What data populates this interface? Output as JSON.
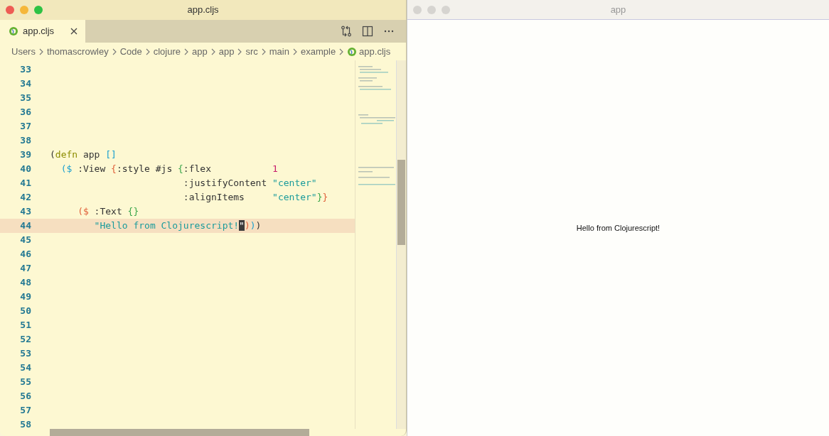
{
  "editor_window": {
    "title": "app.cljs",
    "tabs": [
      {
        "label": "app.cljs",
        "selected": true
      }
    ],
    "breadcrumbs": [
      "Users",
      "thomascrowley",
      "Code",
      "clojure",
      "app",
      "app",
      "src",
      "main",
      "example",
      "app.cljs"
    ],
    "code_lines": [
      {
        "number": "33",
        "highlighted": false
      },
      {
        "number": "34",
        "highlighted": false
      },
      {
        "number": "35",
        "highlighted": false
      },
      {
        "number": "36",
        "highlighted": false
      },
      {
        "number": "37",
        "highlighted": false
      },
      {
        "number": "38",
        "highlighted": false
      },
      {
        "number": "39",
        "highlighted": false,
        "tokens": [
          {
            "kind": "bracket1",
            "text": "("
          },
          {
            "kind": "keyword",
            "text": "defn"
          },
          {
            "kind": "plain",
            "text": " app "
          },
          {
            "kind": "bracket2",
            "text": "[]"
          }
        ]
      },
      {
        "number": "40",
        "highlighted": false,
        "tokens": [
          {
            "kind": "bracket2",
            "text": "  ($"
          },
          {
            "kind": "plain",
            "text": " :View "
          },
          {
            "kind": "bracket3",
            "text": "{"
          },
          {
            "kind": "plain",
            "text": ":style #js "
          },
          {
            "kind": "bracket4",
            "text": "{"
          },
          {
            "kind": "plain",
            "text": ":flex           "
          },
          {
            "kind": "number",
            "text": "1"
          }
        ]
      },
      {
        "number": "41",
        "highlighted": false,
        "tokens": [
          {
            "kind": "plain",
            "text": "                        :justifyContent "
          },
          {
            "kind": "string",
            "text": "\"center\""
          }
        ]
      },
      {
        "number": "42",
        "highlighted": false,
        "tokens": [
          {
            "kind": "plain",
            "text": "                        :alignItems     "
          },
          {
            "kind": "string",
            "text": "\"center\""
          },
          {
            "kind": "bracket4",
            "text": "}"
          },
          {
            "kind": "bracket3",
            "text": "}"
          }
        ]
      },
      {
        "number": "43",
        "highlighted": false,
        "tokens": [
          {
            "kind": "bracket3",
            "text": "     ($"
          },
          {
            "kind": "plain",
            "text": " :Text "
          },
          {
            "kind": "bracket4",
            "text": "{}"
          }
        ]
      },
      {
        "number": "44",
        "highlighted": true,
        "tokens": [
          {
            "kind": "string",
            "text": "        \"Hello from Clojurescript!"
          },
          {
            "kind": "cursor",
            "text": "\""
          },
          {
            "kind": "bracket3",
            "text": ")"
          },
          {
            "kind": "bracket2",
            "text": ")"
          },
          {
            "kind": "bracket1",
            "text": ")"
          }
        ]
      },
      {
        "number": "45",
        "highlighted": false
      },
      {
        "number": "46",
        "highlighted": false
      },
      {
        "number": "47",
        "highlighted": false
      },
      {
        "number": "48",
        "highlighted": false
      },
      {
        "number": "49",
        "highlighted": false
      },
      {
        "number": "50",
        "highlighted": false
      },
      {
        "number": "51",
        "highlighted": false
      },
      {
        "number": "52",
        "highlighted": false
      },
      {
        "number": "53",
        "highlighted": false
      },
      {
        "number": "54",
        "highlighted": false
      },
      {
        "number": "55",
        "highlighted": false
      },
      {
        "number": "56",
        "highlighted": false
      },
      {
        "number": "57",
        "highlighted": false
      },
      {
        "number": "58",
        "highlighted": false
      }
    ]
  },
  "app_window": {
    "title": "app",
    "text": "Hello from Clojurescript!"
  }
}
